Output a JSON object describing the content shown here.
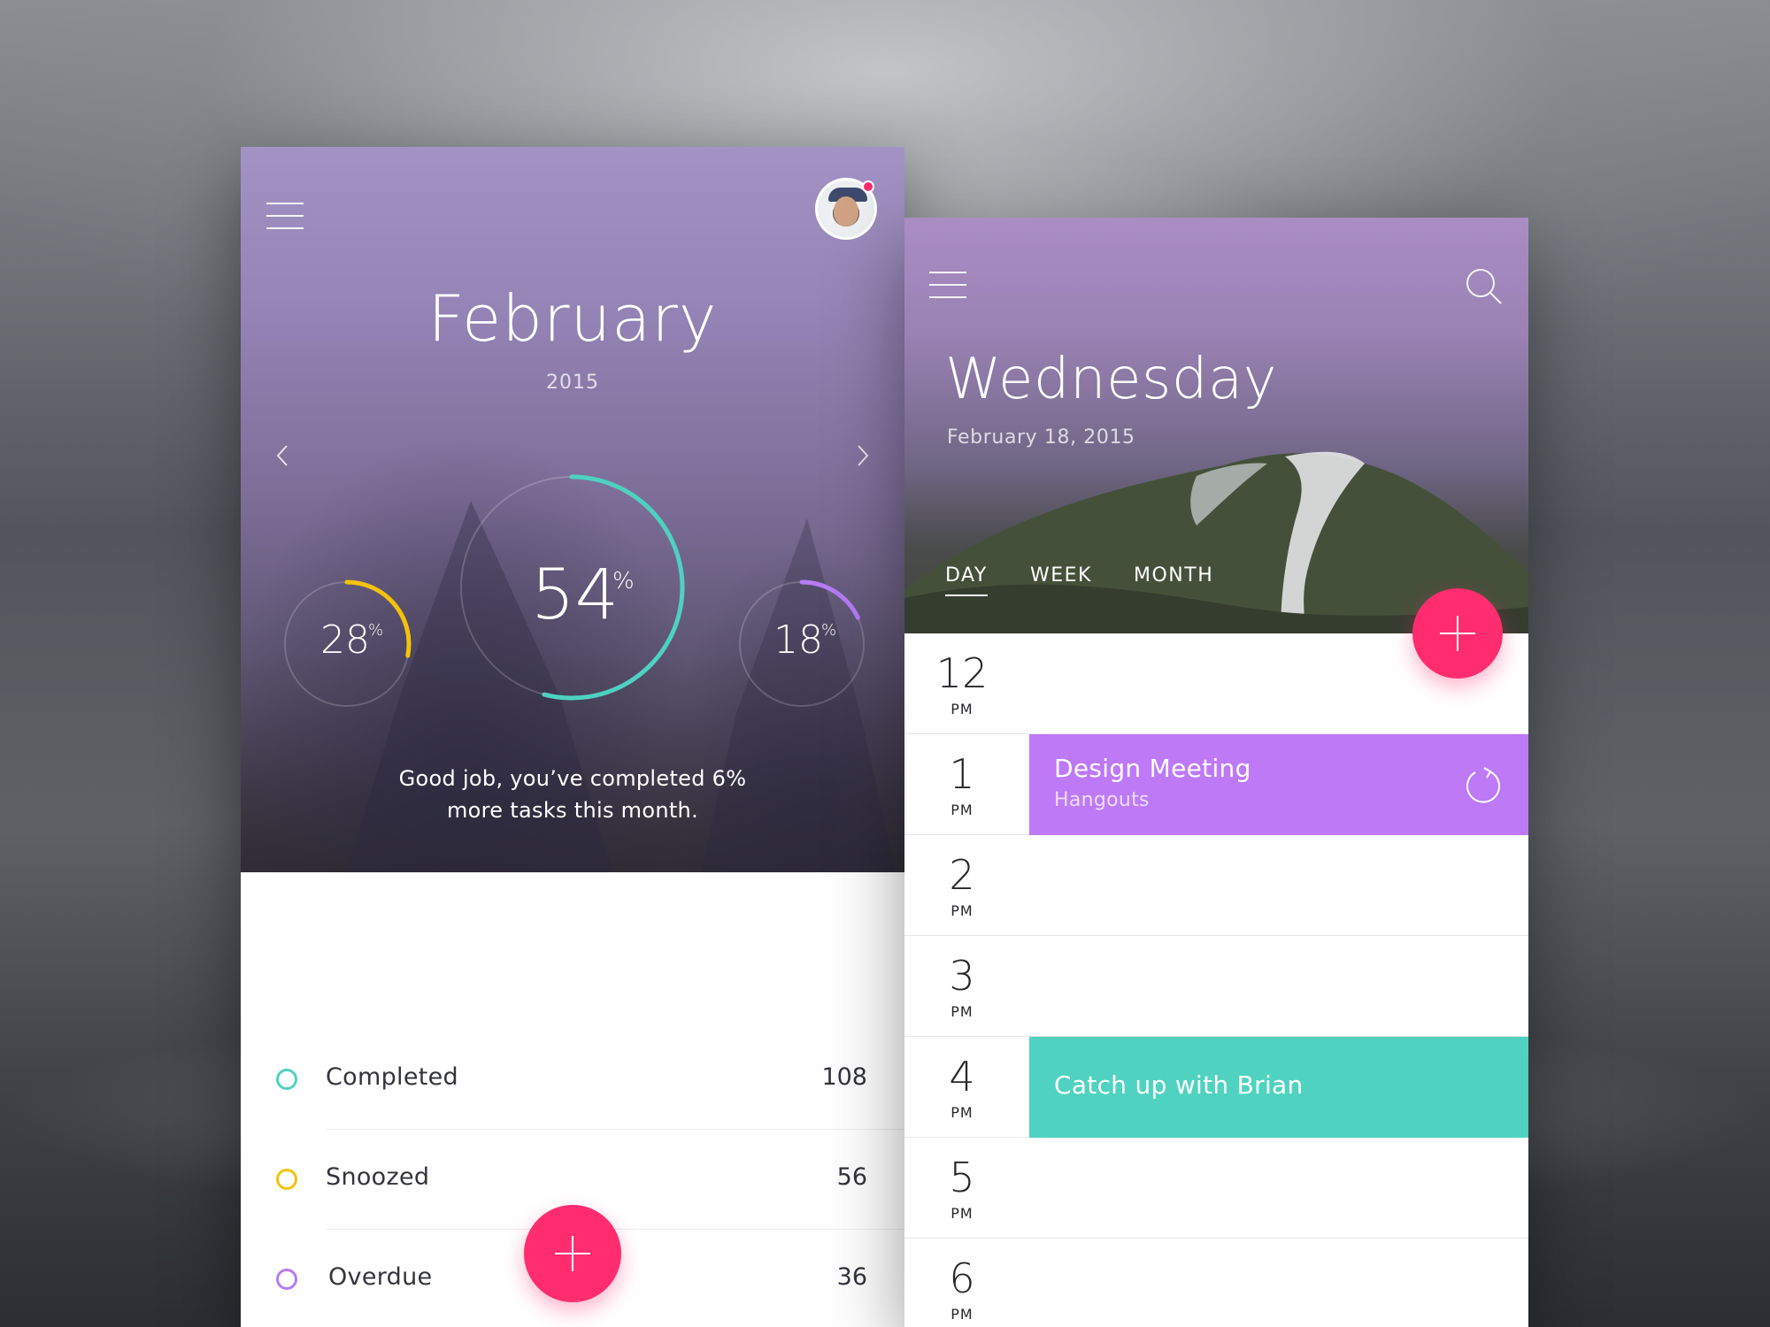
{
  "colors": {
    "accent_pink": "#ff2d6f",
    "teal": "#4fd1c2",
    "yellow": "#f5c20b",
    "purple": "#b57cf5",
    "event_purple": "#be79f7",
    "event_teal": "#4fd3c0"
  },
  "left_screen": {
    "header": {
      "menu_icon": "hamburger-icon",
      "avatar_icon": "user-avatar",
      "notification_icon": "notification-dot"
    },
    "nav": {
      "prev_icon": "chevron-left-icon",
      "next_icon": "chevron-right-icon"
    },
    "month": "February",
    "year": "2015",
    "rings": {
      "left": {
        "value": "28",
        "unit": "%",
        "fraction": 0.28,
        "color": "#f5c20b"
      },
      "center": {
        "value": "54",
        "unit": "%",
        "fraction": 0.54,
        "color": "#4fd1c2"
      },
      "right": {
        "value": "18",
        "unit": "%",
        "fraction": 0.18,
        "color": "#b57cf5"
      }
    },
    "message_line1": "Good job, you’ve completed 6%",
    "message_line2": "more tasks this month.",
    "stats": [
      {
        "label": "Completed",
        "count": "108",
        "color": "#4fd1c2"
      },
      {
        "label": "Snoozed",
        "count": "56",
        "color": "#f5c20b"
      },
      {
        "label": "Overdue",
        "count": "36",
        "color": "#b57cf5"
      }
    ],
    "fab_icon": "plus-icon"
  },
  "right_screen": {
    "header": {
      "menu_icon": "hamburger-icon",
      "search_icon": "search-icon"
    },
    "day": "Wednesday",
    "date": "February 18, 2015",
    "tabs": [
      {
        "label": "DAY",
        "active": true
      },
      {
        "label": "WEEK",
        "active": false
      },
      {
        "label": "MONTH",
        "active": false
      }
    ],
    "fab_icon": "plus-icon",
    "hours": [
      {
        "hour": "12",
        "ampm": "PM"
      },
      {
        "hour": "1",
        "ampm": "PM"
      },
      {
        "hour": "2",
        "ampm": "PM"
      },
      {
        "hour": "3",
        "ampm": "PM"
      },
      {
        "hour": "4",
        "ampm": "PM"
      },
      {
        "hour": "5",
        "ampm": "PM"
      },
      {
        "hour": "6",
        "ampm": "PM"
      }
    ],
    "events": [
      {
        "title": "Design Meeting",
        "subtitle": "Hangouts",
        "hour": "1",
        "color": "#be79f7",
        "icon": "repeat-icon"
      },
      {
        "title": "Catch up with Brian",
        "subtitle": "",
        "hour": "4",
        "color": "#4fd3c0",
        "icon": ""
      }
    ]
  }
}
